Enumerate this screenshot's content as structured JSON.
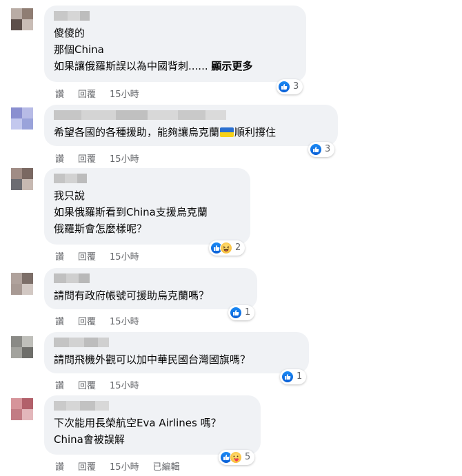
{
  "comments": [
    {
      "lines": [
        "傻傻的",
        "那個China",
        "如果讓俄羅斯誤以為中國背刺......"
      ],
      "see_more": "顯示更多",
      "reaction_count": "3",
      "actions": {
        "like": "讚",
        "reply": "回覆",
        "time": "15小時"
      }
    },
    {
      "line_before_flag": "希望各國的各種援助，能夠讓烏克蘭",
      "line_after_flag": "順利撐住",
      "reaction_count": "3",
      "actions": {
        "like": "讚",
        "reply": "回覆",
        "time": "15小時"
      }
    },
    {
      "lines": [
        "我只說",
        "如果俄羅斯看到China支援烏克蘭",
        "俄羅斯會怎麼樣呢？"
      ],
      "reaction_count": "2",
      "actions": {
        "like": "讚",
        "reply": "回覆",
        "time": "15小時"
      }
    },
    {
      "lines": [
        "請問有政府帳號可援助烏克蘭嗎？"
      ],
      "reaction_count": "1",
      "actions": {
        "like": "讚",
        "reply": "回覆",
        "time": "15小時"
      }
    },
    {
      "lines": [
        "請問飛機外觀可以加中華民國台灣國旗嗎？"
      ],
      "reaction_count": "1",
      "actions": {
        "like": "讚",
        "reply": "回覆",
        "time": "15小時"
      }
    },
    {
      "lines": [
        "下次能用長榮航空Eva Airlines 嗎？",
        "China會被誤解"
      ],
      "reaction_count": "5",
      "actions": {
        "like": "讚",
        "reply": "回覆",
        "time": "15小時",
        "edited": "已編輯"
      }
    }
  ],
  "colors": {
    "bubble_bg": "#f0f2f5",
    "meta_text": "#65676b",
    "like_blue": "#1877f2",
    "flag_blue": "#2a6fcf",
    "flag_yellow": "#f6d11a"
  }
}
